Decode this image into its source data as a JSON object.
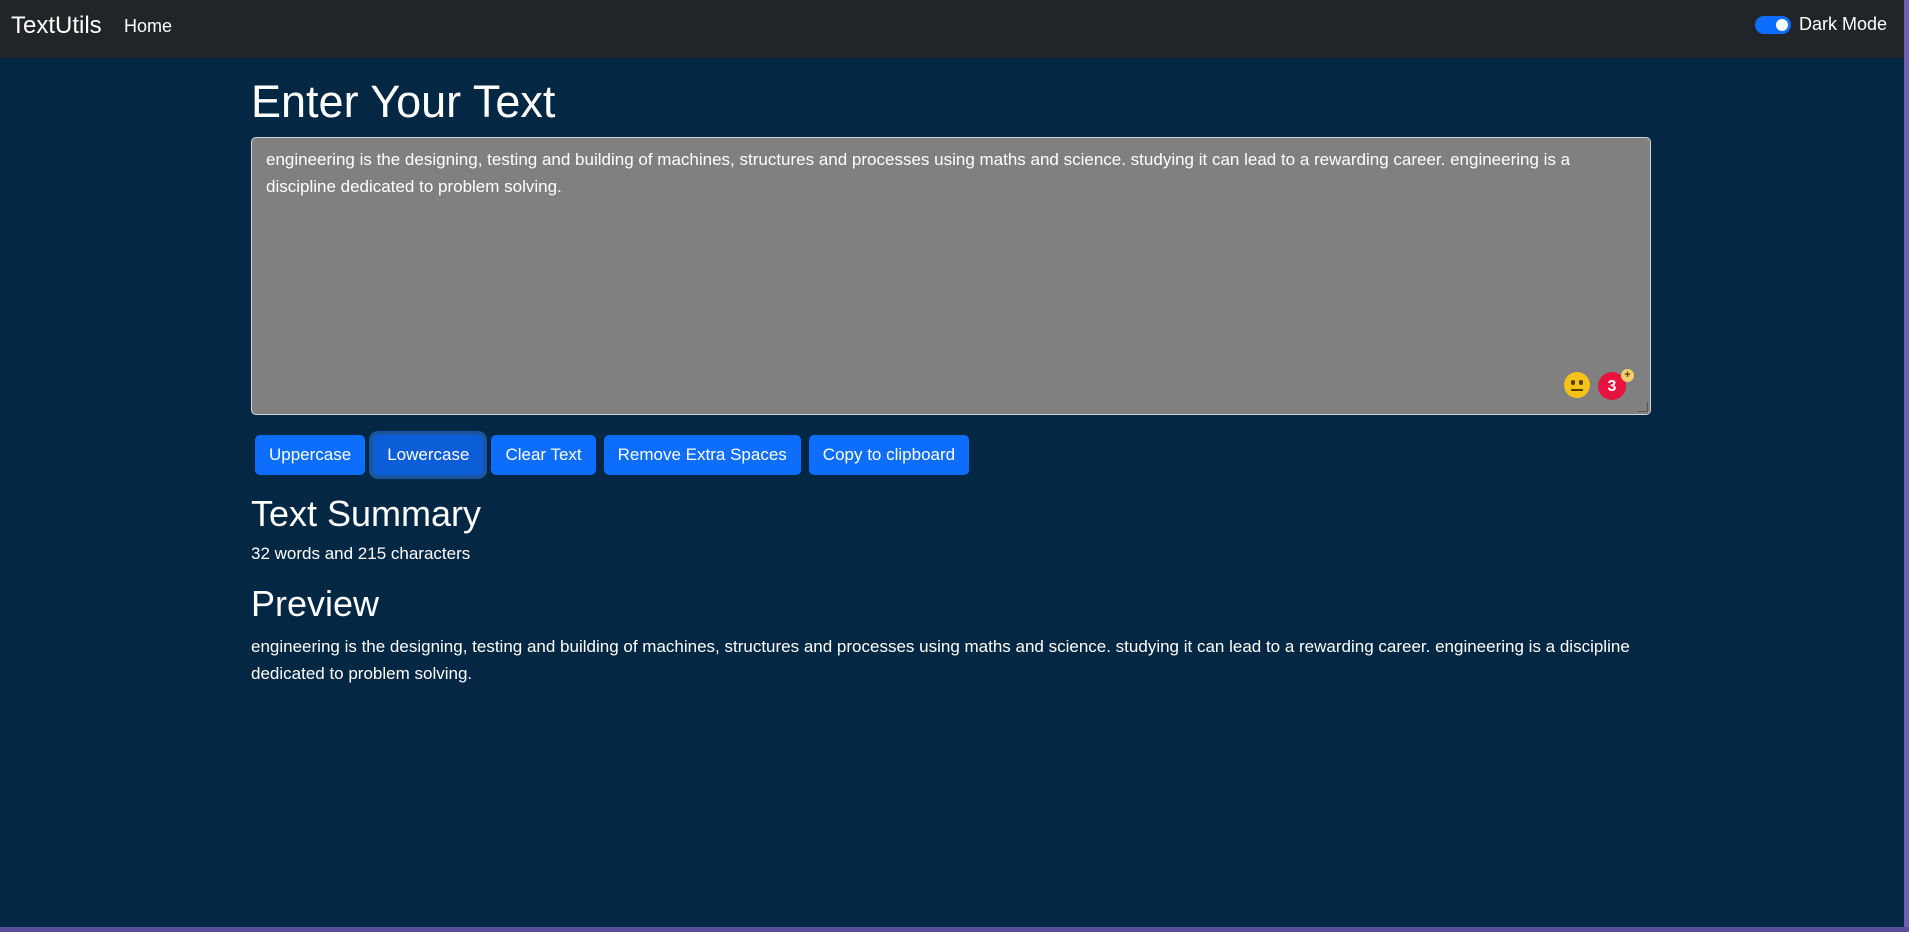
{
  "navbar": {
    "brand": "TextUtils",
    "home": "Home",
    "dark_mode_label": "Dark Mode",
    "dark_mode_on": true
  },
  "main": {
    "title": "Enter Your Text",
    "textarea_value": "engineering is the designing, testing and building of machines, structures and processes using maths and science. studying it can lead to a rewarding career. engineering is a discipline dedicated to problem solving.",
    "extension_badge_count": "3",
    "extension_badge_plus": "+"
  },
  "buttons": {
    "uppercase": "Uppercase",
    "lowercase": "Lowercase",
    "clear": "Clear Text",
    "remove_spaces": "Remove Extra Spaces",
    "copy": "Copy to clipboard"
  },
  "summary": {
    "heading": "Text Summary",
    "text": "32 words and 215 characters"
  },
  "preview": {
    "heading": "Preview",
    "text": "engineering is the designing, testing and building of machines, structures and processes using maths and science. studying it can lead to a rewarding career. engineering is a discipline dedicated to problem solving."
  },
  "colors": {
    "background": "#042743",
    "navbar": "#212529",
    "primary": "#0d6efd",
    "textarea_bg": "#808080"
  }
}
